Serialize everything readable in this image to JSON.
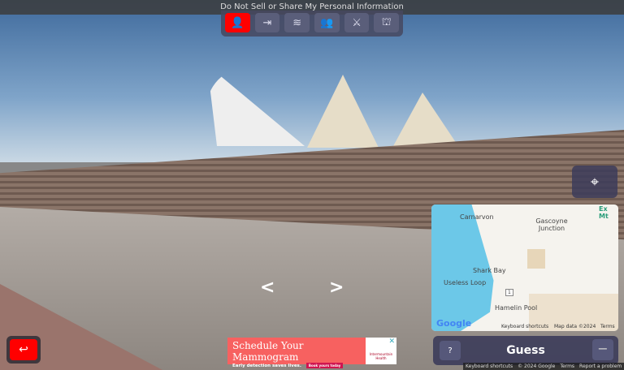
{
  "top_banner": "Do Not Sell or Share My Personal Information",
  "toolbar": {
    "buttons": [
      {
        "name": "profile",
        "icon": "👤"
      },
      {
        "name": "exit",
        "icon": "⇥"
      },
      {
        "name": "layers",
        "icon": "≋"
      },
      {
        "name": "party",
        "icon": "👥"
      },
      {
        "name": "versus",
        "icon": "⚔"
      },
      {
        "name": "leaderboard",
        "icon": "⛫"
      }
    ]
  },
  "map_toggle_icon": "map-pin-icon",
  "map": {
    "labels": [
      "Carnarvon",
      "Gascoyne Junction",
      "Shark Bay",
      "Useless Loop",
      "Hamelin Pool",
      "Ex Mt"
    ],
    "road": "1",
    "logo": "Google",
    "attribution": [
      "Keyboard shortcuts",
      "Map data ©2024",
      "Terms"
    ]
  },
  "guess": {
    "help": "?",
    "label": "Guess",
    "minimize": "−"
  },
  "footer": [
    "Keyboard shortcuts",
    "© 2024 Google",
    "Terms",
    "Report a problem"
  ],
  "back_icon": "↩",
  "ad": {
    "title": "Schedule Your Mammogram",
    "subtitle": "Early detection saves lives.",
    "cta": "Book yours today",
    "brand": "Intermountain Health",
    "close": "✕"
  }
}
